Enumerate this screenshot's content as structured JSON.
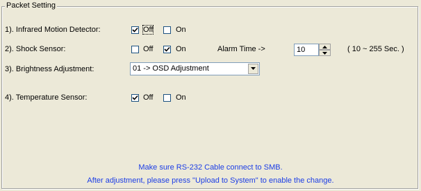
{
  "group_title": "Packet Setting",
  "rows": {
    "infrared": {
      "label": "1). Infrared Motion Detector:",
      "off_label": "Off",
      "on_label": "On",
      "off_checked": true,
      "on_checked": false
    },
    "shock": {
      "label": "2). Shock Sensor:",
      "off_label": "Off",
      "on_label": "On",
      "off_checked": false,
      "on_checked": true
    },
    "brightness": {
      "label": "3). Brightness Adjustment:",
      "selected": "01 -> OSD Adjustment"
    },
    "temperature": {
      "label": "4). Temperature Sensor:",
      "off_label": "Off",
      "on_label": "On",
      "off_checked": true,
      "on_checked": false
    }
  },
  "alarm": {
    "label": "Alarm Time ->",
    "value": "10",
    "range": "( 10 ~ 255 Sec. )"
  },
  "notes": {
    "line1": "Make sure RS-232 Cable connect to SMB.",
    "line2": "After adjustment, please press \"Upload to System\" to enable the change."
  },
  "colors": {
    "note_text": "#1a3ce6",
    "background": "#ece9d8"
  }
}
